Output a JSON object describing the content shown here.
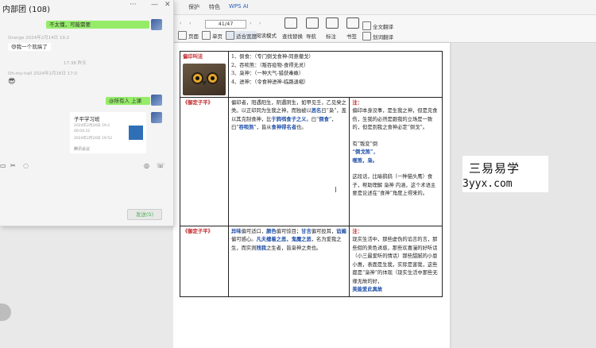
{
  "chat": {
    "title": "内部团 (108)",
    "messages": {
      "m1": "不太懂，可能需要",
      "m2_meta": "Orange 2024年2月14日 19:2",
      "m2": "我一个就搞了",
      "m3_meta": "17:38 昨天",
      "m4_meta": "Oh-my-hall 2024年2月16日 17:0",
      "m5": "@所有人  上课",
      "card_title": "子平学习班",
      "card_line1": "2024年2月24日 19:2",
      "card_line2": "00:04:22",
      "card_line3": "2024年2月24日 19:52",
      "card_footer": "腾讯会议"
    },
    "send_label": "发送(S)",
    "icons": [
      "folder-icon",
      "scissors-icon",
      "chat-history-icon",
      "mic-icon",
      "phone-icon"
    ]
  },
  "doc": {
    "tabs": [
      "保护",
      "特色",
      "WPS AI"
    ],
    "page_indicator": "41/47",
    "ribbon": {
      "read_mode": "阅读模式",
      "page_view": "页面",
      "single": "单页",
      "double": "双页",
      "zoom": "适合宽度",
      "find": "查找替换",
      "outline": "导航",
      "annotate": "标注",
      "bookmark": "书签",
      "convert": "全文翻译",
      "translate": "划词翻译"
    },
    "row1": {
      "title": "偏印叫法",
      "items": [
        "1、倒食：（专门倒戈食神-同意撤戈）",
        "2、吞啖煞：（叛吞疫物-食得无灵）",
        "3、枭神：（一种大气-猎获毒蛛）",
        "4、进神：（令食神进神-临路退缩）"
      ]
    },
    "row2": {
      "title": "《御定子平》",
      "body_1": "偏印者，阳遇阳生，阴遇阴生，如甲见壬，乙见癸之类。以正印同为生我之神，而独被以",
      "body_bold1": "恶名",
      "body_2": "曰“枭”，盖以其克制食神，比",
      "body_bold2": "于鸦鸮食子之义",
      "body_3": "。曰“",
      "body_bold3": "倒食",
      "body_4": "”，曰“",
      "body_bold4": "吞啖煞",
      "body_5": "”，皆从",
      "body_bold5": "食神得名者",
      "body_6": "也。",
      "note_label": "注：",
      "note_1": "偏印本身没事，是生我之神，但是克食伤，生我的必然是跟我的立场是一致的，但是到我之食神必定“倒戈”。",
      "note_2a": "有“叛变”倒",
      "note_2b": "“倒戈煞”，",
      "note_2c": "噬煞，枭。",
      "note_3": "这段话，比喻鹞鸱（一种猫头鹰）食子，帮助理解 枭神 内涵，这个术语主要是论述在“食神”角度上得来的。"
    },
    "row3": {
      "title": "《御定子平》",
      "body_a": "异味",
      "body_b": "偏可适口，",
      "body_c": "颜色",
      "body_d": "偏可惊目；",
      "body_e": "甘言",
      "body_f": "偏可投耳，",
      "body_g": "谄媚",
      "body_h": "偏可感心。",
      "body_i": "凡夫缠着之恶，鬼",
      "body_j": "魔之恶",
      "body_k": "，名为爱我之生，而实则",
      "body_l": "残我",
      "body_m": "之生者，皆枭神之类也。",
      "note_label": "注：",
      "note_body": "现实生活中，那些虚伪的谄言的言，那些假的美色诱惑，那些欢喜漫的好听话（小三最爱听的情话）那些甜腻的小恩小惠，表面是生我，实际是害我，这些都是“枭神”的体现（现实生活中那些无缘无故的好，",
      "note_tail": "美能爱此真故"
    }
  },
  "watermark": {
    "line1": "三易易学",
    "line2": "3yyx.com"
  }
}
